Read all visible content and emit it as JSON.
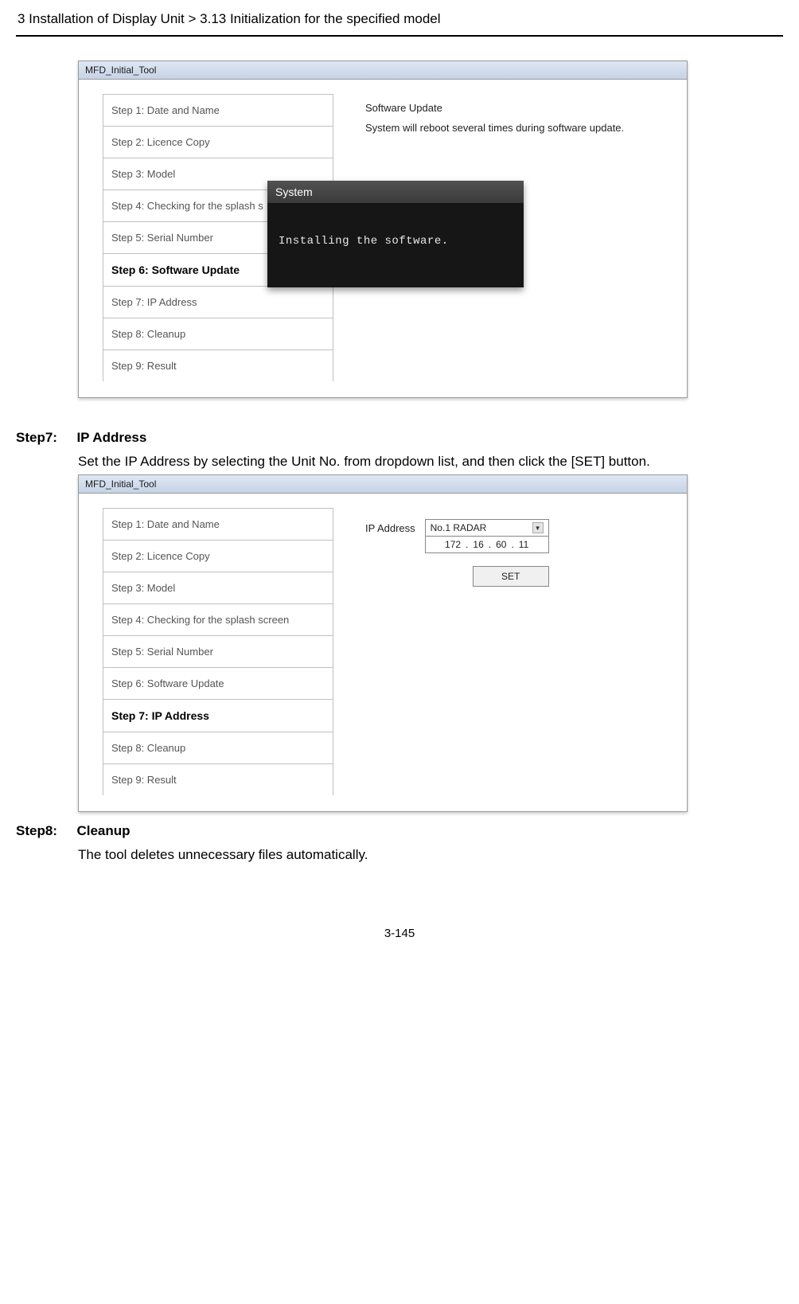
{
  "header": "3 Installation of Display Unit > 3.13 Initialization for the specified model",
  "page_number": "3-145",
  "shot1": {
    "title": "MFD_Initial_Tool",
    "steps": [
      "Step 1: Date and Name",
      "Step 2: Licence Copy",
      "Step 3: Model",
      "Step 4: Checking for the splash s",
      "Step 5: Serial Number",
      "Step 6: Software Update",
      "Step 7: IP Address",
      "Step 8: Cleanup",
      "Step 9: Result"
    ],
    "active_index": 5,
    "main_line1": "Software Update",
    "main_line2": "System will reboot several times during software update.",
    "dialog_title": "System",
    "dialog_body": "Installing the software."
  },
  "step7": {
    "label": "Step7:",
    "title": "IP Address",
    "desc": "Set the IP Address by selecting the Unit No. from dropdown list, and then click the [SET] button."
  },
  "shot2": {
    "title": "MFD_Initial_Tool",
    "steps": [
      "Step 1: Date and Name",
      "Step 2: Licence Copy",
      "Step 3: Model",
      "Step 4: Checking for the splash screen",
      "Step 5: Serial Number",
      "Step 6: Software Update",
      "Step 7: IP Address",
      "Step 8: Cleanup",
      "Step 9: Result"
    ],
    "active_index": 6,
    "ip_label": "IP Address",
    "dropdown_value": "No.1 RADAR",
    "ip": {
      "a": "172",
      "b": "16",
      "c": "60",
      "d": "11"
    },
    "set_label": "SET"
  },
  "step8": {
    "label": "Step8:",
    "title": "Cleanup",
    "desc": "The tool deletes unnecessary files automatically."
  }
}
